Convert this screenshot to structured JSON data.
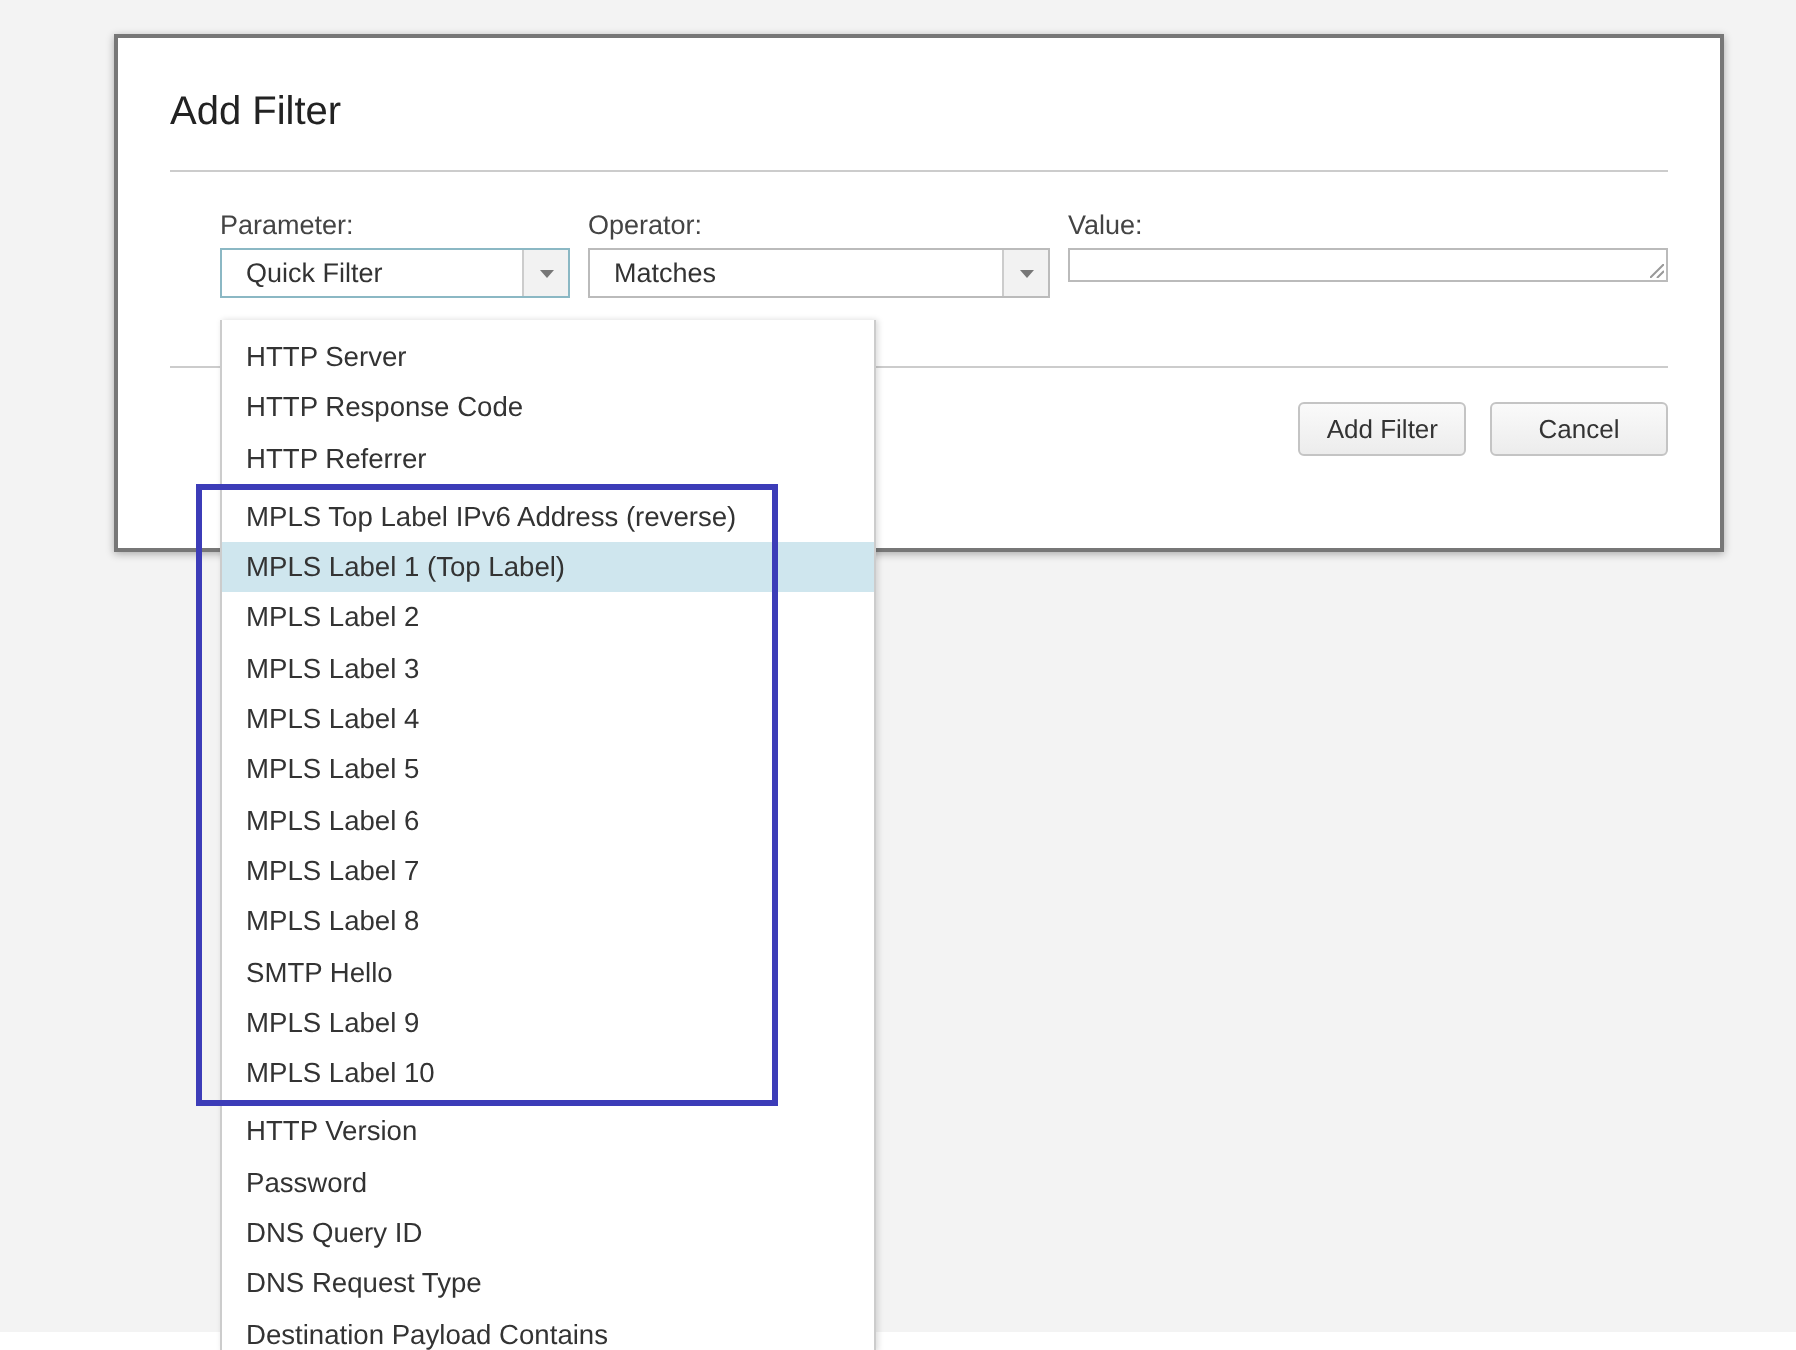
{
  "dialog": {
    "title": "Add Filter",
    "fields": [
      {
        "kind": "select",
        "label": "Parameter:",
        "value": "Quick Filter",
        "open": true
      },
      {
        "kind": "select",
        "label": "Operator:",
        "value": "Matches",
        "open": false
      },
      {
        "kind": "textarea",
        "label": "Value:"
      }
    ],
    "buttons": [
      "Add Filter",
      "Cancel"
    ]
  },
  "dropdown": {
    "sections": [
      {
        "boxed": false,
        "items": [
          {
            "label": "HTTP Server",
            "selected": false
          },
          {
            "label": "HTTP Response Code",
            "selected": false
          },
          {
            "label": "HTTP Referrer",
            "selected": false
          }
        ]
      },
      {
        "boxed": true,
        "items": [
          {
            "label": "MPLS Top Label IPv6 Address (reverse)",
            "selected": false
          },
          {
            "label": "MPLS Label 1 (Top Label)",
            "selected": true
          },
          {
            "label": "MPLS Label 2",
            "selected": false
          },
          {
            "label": "MPLS Label 3",
            "selected": false
          },
          {
            "label": "MPLS Label 4",
            "selected": false
          },
          {
            "label": "MPLS Label 5",
            "selected": false
          },
          {
            "label": "MPLS Label 6",
            "selected": false
          },
          {
            "label": "MPLS Label 7",
            "selected": false
          },
          {
            "label": "MPLS Label 8",
            "selected": false
          },
          {
            "label": "SMTP Hello",
            "selected": false
          },
          {
            "label": "MPLS Label 9",
            "selected": false
          },
          {
            "label": "MPLS Label 10",
            "selected": false
          }
        ]
      },
      {
        "boxed": false,
        "items": [
          {
            "label": "HTTP Version",
            "selected": false
          },
          {
            "label": "Password",
            "selected": false
          },
          {
            "label": "DNS Query ID",
            "selected": false
          },
          {
            "label": "DNS Request Type",
            "selected": false
          },
          {
            "label": "Destination Payload Contains",
            "selected": false
          }
        ]
      }
    ]
  }
}
